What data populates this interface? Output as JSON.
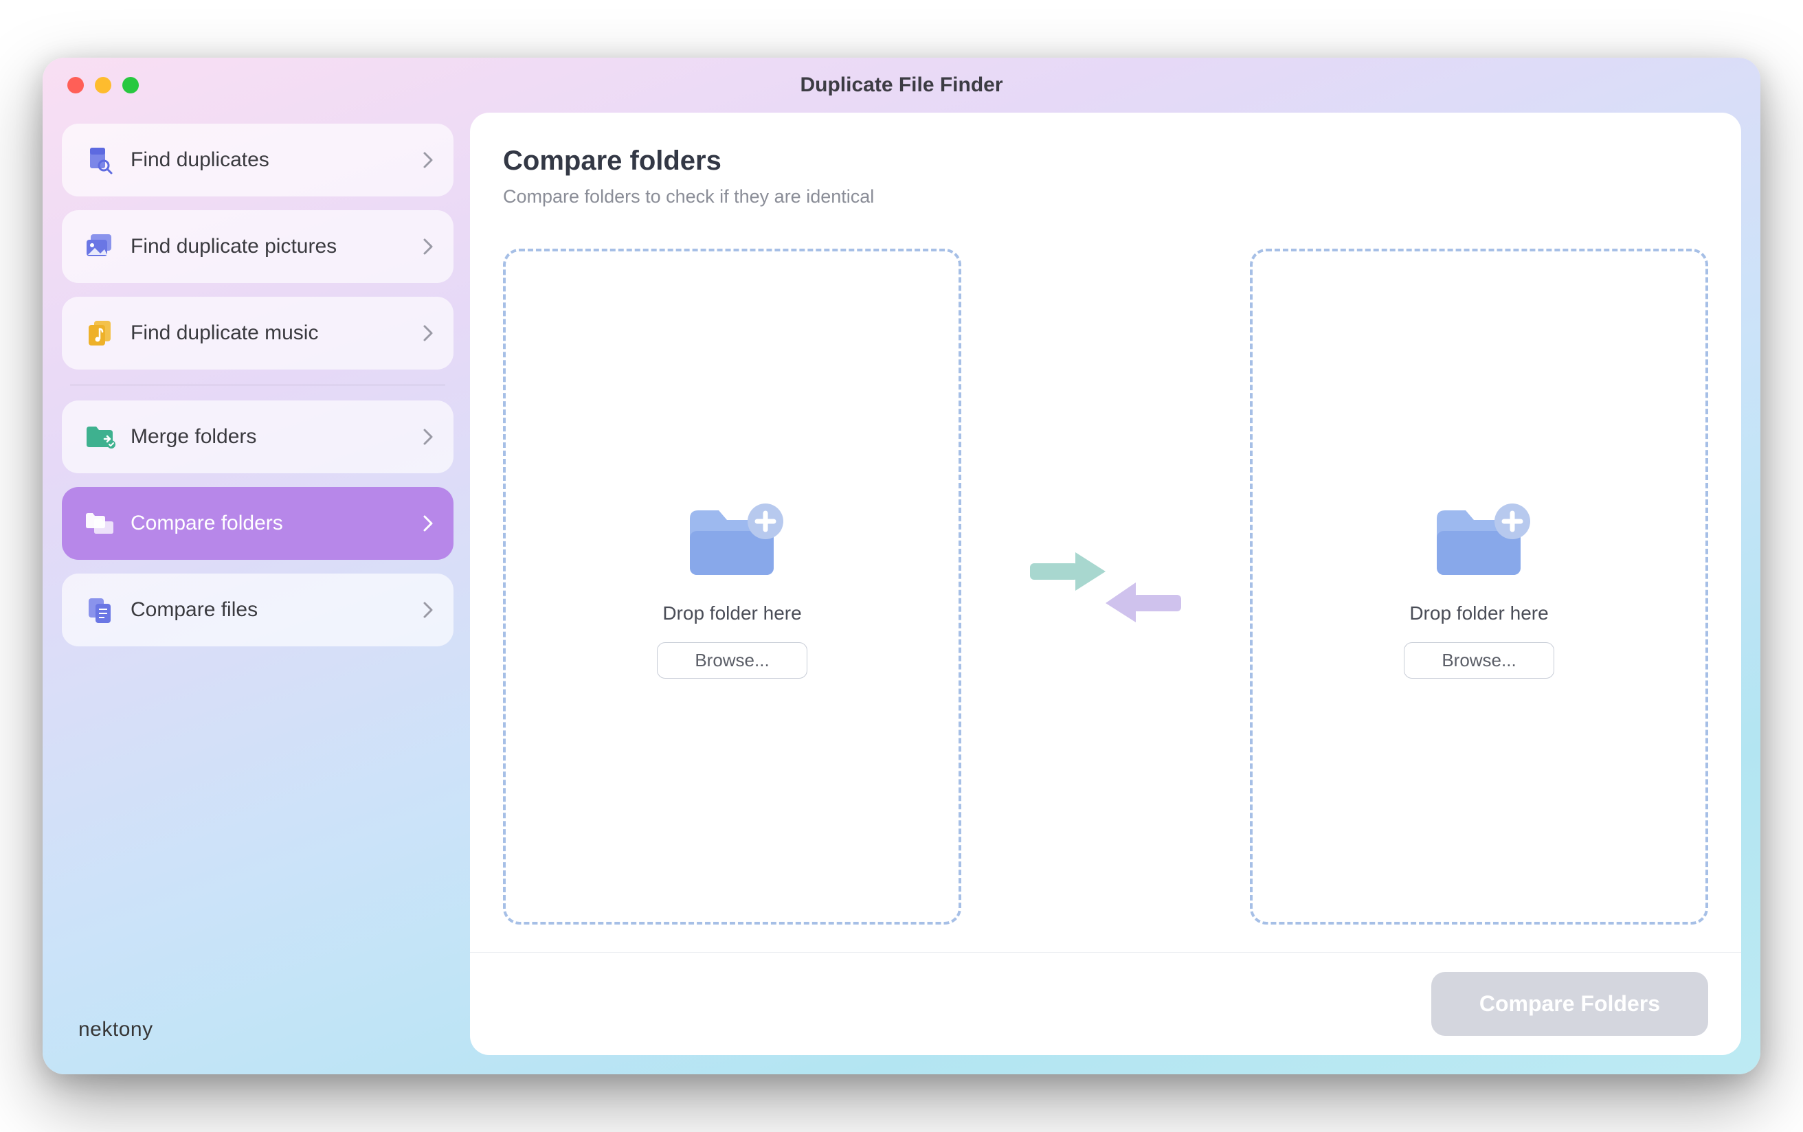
{
  "window": {
    "title": "Duplicate File Finder"
  },
  "brand": "nektony",
  "sidebar": {
    "items": [
      {
        "label": "Find duplicates",
        "icon": "doc-search",
        "active": false
      },
      {
        "label": "Find duplicate pictures",
        "icon": "pictures",
        "active": false
      },
      {
        "label": "Find duplicate music",
        "icon": "music",
        "active": false
      },
      {
        "label": "Merge folders",
        "icon": "folder-merge",
        "active": false
      },
      {
        "label": "Compare folders",
        "icon": "folder-compare",
        "active": true
      },
      {
        "label": "Compare files",
        "icon": "files-compare",
        "active": false
      }
    ]
  },
  "main": {
    "title": "Compare folders",
    "subtitle": "Compare folders to check if they are identical",
    "dropzone_left": {
      "label": "Drop folder here",
      "browse": "Browse..."
    },
    "dropzone_right": {
      "label": "Drop folder here",
      "browse": "Browse..."
    },
    "compare_button": "Compare Folders"
  }
}
